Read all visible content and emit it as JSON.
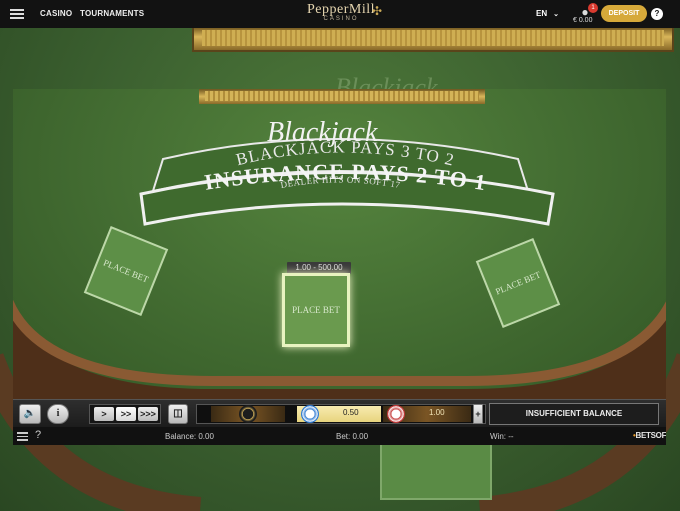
{
  "nav": {
    "links": [
      "CASINO",
      "TOURNAMENTS"
    ],
    "brand": "PepperMill",
    "brand_sub": "CASINO",
    "language": "EN",
    "notification_count": "1",
    "balance": "€ 0.00",
    "deposit_label": "DEPOSIT",
    "help_label": "?"
  },
  "table": {
    "title": "Blackjack",
    "ribbon_top": "BLACKJACK PAYS 3 TO 2",
    "ribbon_sub": "DEALER HITS ON SOFT 17",
    "ribbon_main": "INSURANCE PAYS 2 TO 1",
    "bet_label": "PLACE BET",
    "bet_range": "1.00 - 500.00"
  },
  "controls": {
    "sound_icon": "speaker-icon",
    "info_label": "i",
    "speeds": [
      ">",
      ">>",
      ">>>"
    ],
    "chips": [
      "0.50",
      "1.00"
    ],
    "minus": "−",
    "plus": "+",
    "message": "INSUFFICIENT BALANCE"
  },
  "status": {
    "balance": "Balance: 0.00",
    "bet": "Bet: 0.00",
    "win": "Win: --",
    "help": "?",
    "provider_prefix": "•",
    "provider_brand": "BETSOFT"
  },
  "colors": {
    "felt": "#426b31",
    "gold": "#d6a93a",
    "notification": "#d93a2f"
  }
}
